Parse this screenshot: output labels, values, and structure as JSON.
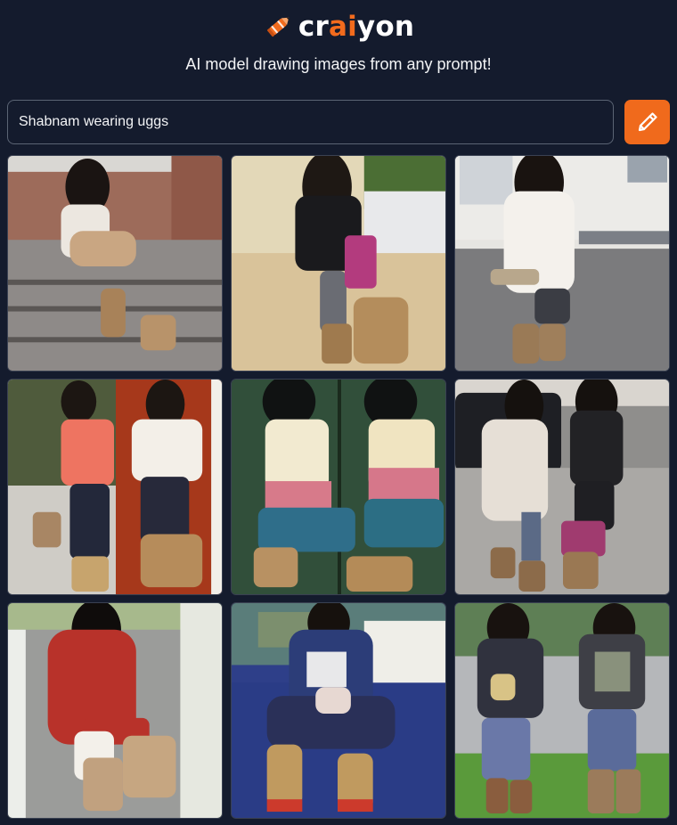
{
  "brand": {
    "name_prefix": "cr",
    "name_accent": "ai",
    "name_suffix": "yon",
    "logo_icon": "crayon-pencil-icon",
    "tagline": "AI model drawing images from any prompt!"
  },
  "colors": {
    "background": "#141b2d",
    "accent": "#f06a1c",
    "input_border": "#5b6474",
    "text": "#f3f4f6"
  },
  "prompt": {
    "value": "Shabnam wearing uggs",
    "placeholder": "",
    "button_icon": "pencil-icon"
  },
  "results": [
    {
      "id": 1,
      "scene": "woman in white top sitting on brick steps in tan boots"
    },
    {
      "id": 2,
      "scene": "woman in black cardigan, grey jeggings and chestnut boots"
    },
    {
      "id": 3,
      "scene": "woman in white blazer holding skateboard outside building"
    },
    {
      "id": 4,
      "scene": "two women in coral and white tops with tall boots"
    },
    {
      "id": 5,
      "scene": "two women in cream tops with blue jeans, green backdrop"
    },
    {
      "id": 6,
      "scene": "two women in sweater and black top on street"
    },
    {
      "id": 7,
      "scene": "woman in red knit sweater and white leggings with boots"
    },
    {
      "id": 8,
      "scene": "woman in navy jacket sitting on blue carpet"
    },
    {
      "id": 9,
      "scene": "two women in dark jackets and denim with brown boots"
    }
  ]
}
